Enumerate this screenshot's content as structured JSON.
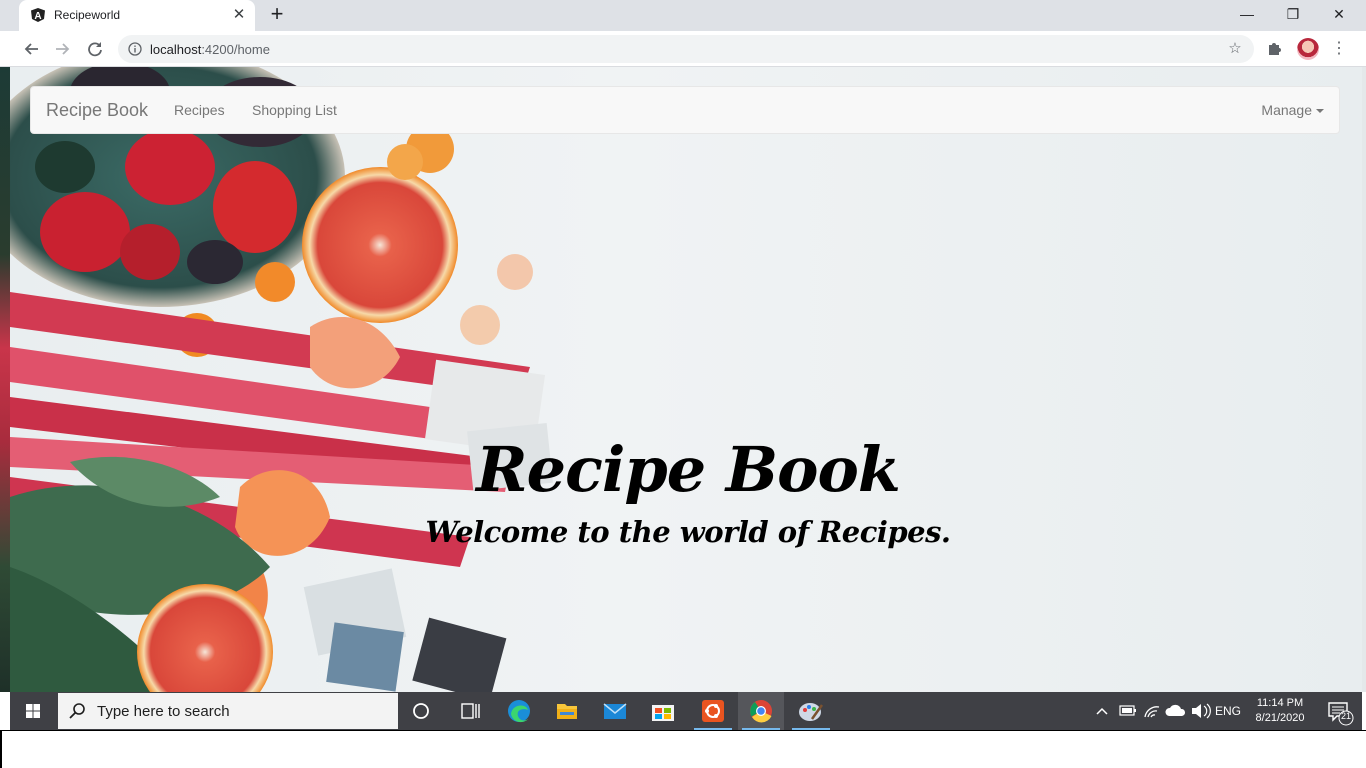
{
  "browser": {
    "tab_title": "Recipeworld",
    "tab_close": "✕",
    "new_tab": "+",
    "url_host": "localhost",
    "url_path": ":4200/home",
    "window_minimize": "—",
    "window_restore": "❐",
    "window_close": "✕"
  },
  "navbar": {
    "brand": "Recipe Book",
    "links": [
      "Recipes",
      "Shopping List"
    ],
    "dropdown": "Manage"
  },
  "hero": {
    "title": "Recipe Book",
    "subtitle": "Welcome to the world of Recipes."
  },
  "taskbar": {
    "search_placeholder": "Type here to search",
    "language": "ENG",
    "time": "11:14 PM",
    "date": "8/21/2020",
    "notification_count": "21"
  },
  "colors": {
    "navbar_bg": "#f8f8f8",
    "navbar_text": "#777777",
    "taskbar_bg": "#3f4045",
    "taskbar_accent": "#76b9ed"
  }
}
